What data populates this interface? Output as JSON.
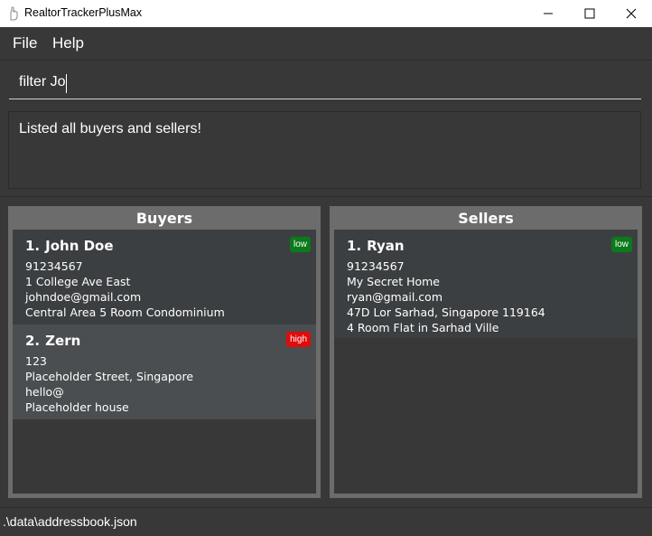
{
  "window": {
    "title": "RealtorTrackerPlusMax",
    "app_icon": "hand-icon",
    "controls": [
      "minimize-icon",
      "maximize-icon",
      "close-icon"
    ]
  },
  "menu": {
    "file": "File",
    "help": "Help"
  },
  "command": {
    "value": "filter Jo"
  },
  "result": {
    "message": "Listed all buyers and sellers!"
  },
  "buyers": {
    "title": "Buyers",
    "items": [
      {
        "index": "1.",
        "name": "John Doe",
        "phone": "91234567",
        "address": "1 College Ave East",
        "email": "johndoe@gmail.com",
        "property": "Central Area 5 Room Condominium",
        "priority": "low"
      },
      {
        "index": "2.",
        "name": "Zern",
        "phone": "123",
        "address": "Placeholder Street, Singapore",
        "email": "hello@",
        "property": "Placeholder house",
        "priority": "high"
      }
    ]
  },
  "sellers": {
    "title": "Sellers",
    "items": [
      {
        "index": "1.",
        "name": "Ryan",
        "phone": "91234567",
        "address": "My Secret Home",
        "email": "ryan@gmail.com",
        "selling_address": "47D Lor Sarhad, Singapore 119164",
        "property": "4 Room Flat in Sarhad Ville",
        "priority": "low"
      }
    ]
  },
  "status": {
    "path": ".\\data\\addressbook.json"
  },
  "colors": {
    "background": "#383838",
    "panel_border": "#6c6c6c",
    "card_odd": "#3c3f41",
    "card_even": "#4a4e50",
    "priority_low": "#0b7a1a",
    "priority_high": "#e00b0b"
  }
}
